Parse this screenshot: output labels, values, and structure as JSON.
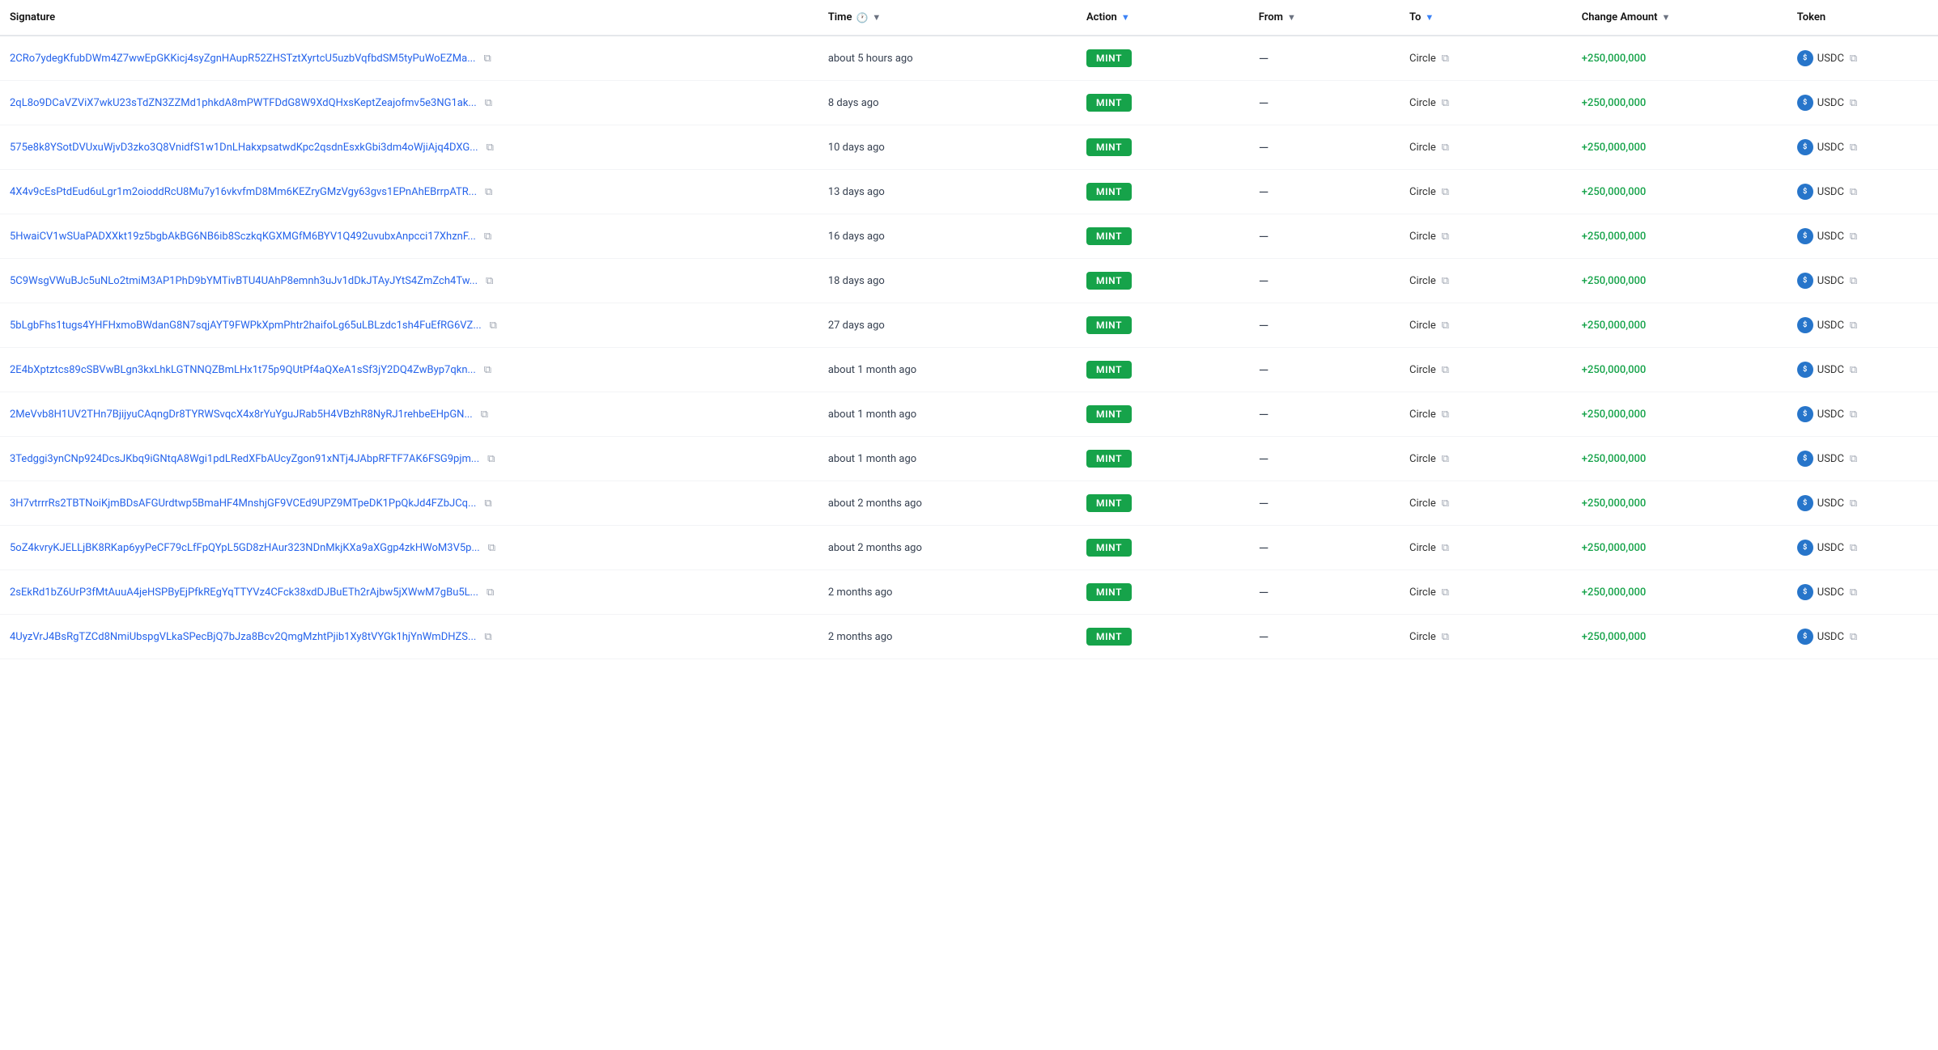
{
  "header": {
    "columns": {
      "signature": "Signature",
      "time": "Time",
      "action": "Action",
      "from": "From",
      "to": "To",
      "change_amount": "Change Amount",
      "token": "Token"
    }
  },
  "rows": [
    {
      "signature": "2CRo7ydegKfubDWm4Z7wwEpGKKicj4syZgnHAupR52ZHSTztXyrtcU5uzbVqfbdSM5tyPuWoEZMa...",
      "time": "about 5 hours ago",
      "action": "MINT",
      "from": "—",
      "to": "Circle",
      "change_amount": "+250,000,000",
      "token": "USDC"
    },
    {
      "signature": "2qL8o9DCaVZViX7wkU23sTdZN3ZZMd1phkdA8mPWTFDdG8W9XdQHxsKeptZeajofmv5e3NG1ak...",
      "time": "8 days ago",
      "action": "MINT",
      "from": "—",
      "to": "Circle",
      "change_amount": "+250,000,000",
      "token": "USDC"
    },
    {
      "signature": "575e8k8YSotDVUxuWjvD3zko3Q8VnidfS1w1DnLHakxpsatwdKpc2qsdnEsxkGbi3dm4oWjiAjq4DXG...",
      "time": "10 days ago",
      "action": "MINT",
      "from": "—",
      "to": "Circle",
      "change_amount": "+250,000,000",
      "token": "USDC"
    },
    {
      "signature": "4X4v9cEsPtdEud6uLgr1m2oioddRcU8Mu7y16vkvfmD8Mm6KEZryGMzVgy63gvs1EPnAhEBrrpATR...",
      "time": "13 days ago",
      "action": "MINT",
      "from": "—",
      "to": "Circle",
      "change_amount": "+250,000,000",
      "token": "USDC"
    },
    {
      "signature": "5HwaiCV1wSUaPADXXkt19z5bgbAkBG6NB6ib8SczkqKGXMGfM6BYV1Q492uvubxAnpcci17XhznF...",
      "time": "16 days ago",
      "action": "MINT",
      "from": "—",
      "to": "Circle",
      "change_amount": "+250,000,000",
      "token": "USDC"
    },
    {
      "signature": "5C9WsgVWuBJc5uNLo2tmiM3AP1PhD9bYMTivBTU4UAhP8emnh3uJv1dDkJTAyJYtS4ZmZch4Tw...",
      "time": "18 days ago",
      "action": "MINT",
      "from": "—",
      "to": "Circle",
      "change_amount": "+250,000,000",
      "token": "USDC"
    },
    {
      "signature": "5bLgbFhs1tugs4YHFHxmoBWdanG8N7sqjAYT9FWPkXpmPhtr2haifoLg65uLBLzdc1sh4FuEfRG6VZ...",
      "time": "27 days ago",
      "action": "MINT",
      "from": "—",
      "to": "Circle",
      "change_amount": "+250,000,000",
      "token": "USDC"
    },
    {
      "signature": "2E4bXptztcs89cSBVwBLgn3kxLhkLGTNNQZBmLHx1t75p9QUtPf4aQXeA1sSf3jY2DQ4ZwByp7qkn...",
      "time": "about 1 month ago",
      "action": "MINT",
      "from": "—",
      "to": "Circle",
      "change_amount": "+250,000,000",
      "token": "USDC"
    },
    {
      "signature": "2MeVvb8H1UV2THn7BjijyuCAqngDr8TYRWSvqcX4x8rYuYguJRab5H4VBzhR8NyRJ1rehbeEHpGN...",
      "time": "about 1 month ago",
      "action": "MINT",
      "from": "—",
      "to": "Circle",
      "change_amount": "+250,000,000",
      "token": "USDC"
    },
    {
      "signature": "3Tedggi3ynCNp924DcsJKbq9iGNtqA8Wgi1pdLRedXFbAUcyZgon91xNTj4JAbpRFTF7AK6FSG9pjm...",
      "time": "about 1 month ago",
      "action": "MINT",
      "from": "—",
      "to": "Circle",
      "change_amount": "+250,000,000",
      "token": "USDC"
    },
    {
      "signature": "3H7vtrrrRs2TBTNoiKjmBDsAFGUrdtwp5BmaHF4MnshjGF9VCEd9UPZ9MTpeDK1PpQkJd4FZbJCq...",
      "time": "about 2 months ago",
      "action": "MINT",
      "from": "—",
      "to": "Circle",
      "change_amount": "+250,000,000",
      "token": "USDC"
    },
    {
      "signature": "5oZ4kvryKJELLjBK8RKap6yyPeCF79cLfFpQYpL5GD8zHAur323NDnMkjKXa9aXGgp4zkHWoM3V5p...",
      "time": "about 2 months ago",
      "action": "MINT",
      "from": "—",
      "to": "Circle",
      "change_amount": "+250,000,000",
      "token": "USDC"
    },
    {
      "signature": "2sEkRd1bZ6UrP3fMtAuuA4jeHSPByEjPfkREgYqTTYVz4CFck38xdDJBuETh2rAjbw5jXWwM7gBu5L...",
      "time": "2 months ago",
      "action": "MINT",
      "from": "—",
      "to": "Circle",
      "change_amount": "+250,000,000",
      "token": "USDC"
    },
    {
      "signature": "4UyzVrJ4BsRgTZCd8NmiUbspgVLkaSPecBjQ7bJza8Bcv2QmgMzhtPjib1Xy8tVYGk1hjYnWmDHZS...",
      "time": "2 months ago",
      "action": "MINT",
      "from": "—",
      "to": "Circle",
      "change_amount": "+250,000,000",
      "token": "USDC"
    }
  ],
  "icons": {
    "copy": "⧉",
    "filter": "▼",
    "clock": "🕐",
    "usdc_label": "$"
  }
}
